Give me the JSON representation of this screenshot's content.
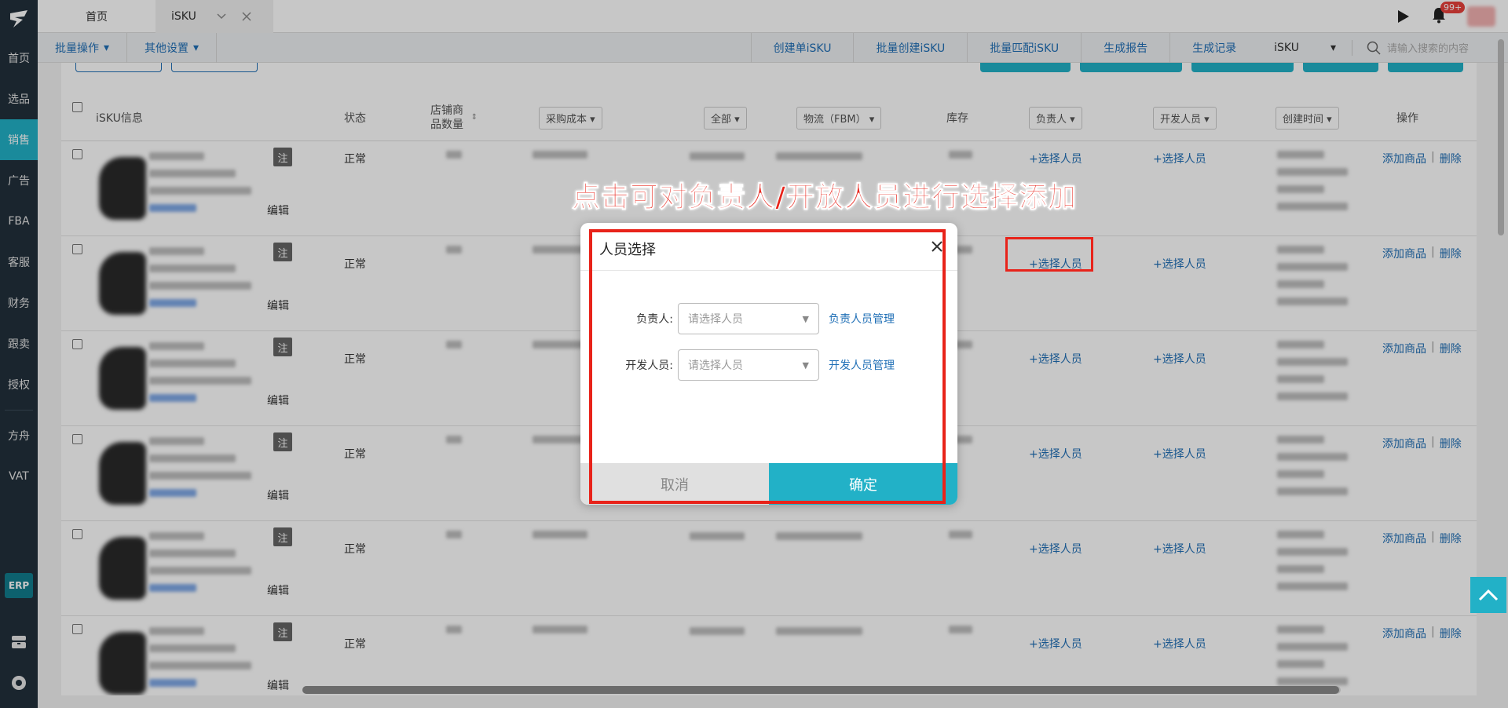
{
  "sidebar": {
    "items": [
      "首页",
      "选品",
      "销售",
      "广告",
      "FBA",
      "客服",
      "财务",
      "跟卖",
      "授权",
      "方舟",
      "VAT"
    ],
    "active_index": 2,
    "erp_label": "ERP"
  },
  "tabs": {
    "home": "首页",
    "active": "iSKU"
  },
  "notifications": {
    "badge": "99+"
  },
  "toolbar": {
    "batch_ops": "批量操作",
    "other_settings": "其他设置",
    "links": [
      "创建单iSKU",
      "批量创建iSKU",
      "批量匹配iSKU",
      "生成报告",
      "生成记录"
    ],
    "select_value": "iSKU",
    "search_placeholder": "请输入搜索的内容"
  },
  "table": {
    "headers": {
      "info": "iSKU信息",
      "status": "状态",
      "store_count": "店铺商品数量",
      "cost": "采购成本",
      "all": "全部",
      "logistics": "物流（FBM）",
      "stock": "库存",
      "owner": "负责人",
      "developer": "开发人员",
      "created": "创建时间",
      "ops": "操作"
    },
    "tag_label": "注",
    "edit_label": "编辑",
    "status_value": "正常",
    "pick_label": "+选择人员",
    "op_add": "添加商品",
    "op_delete": "删除",
    "row_count": 6
  },
  "annotation": {
    "text": "点击可对负责人/开放人员进行选择添加"
  },
  "modal": {
    "title": "人员选择",
    "owner_label": "负责人:",
    "developer_label": "开发人员:",
    "placeholder": "请选择人员",
    "owner_manage": "负责人员管理",
    "developer_manage": "开发人员管理",
    "cancel": "取消",
    "confirm": "确定"
  },
  "colors": {
    "accent": "#22b1c7",
    "link": "#1f6fb6",
    "annotation_red": "#e8231a",
    "sidebar_bg": "#22303c"
  }
}
